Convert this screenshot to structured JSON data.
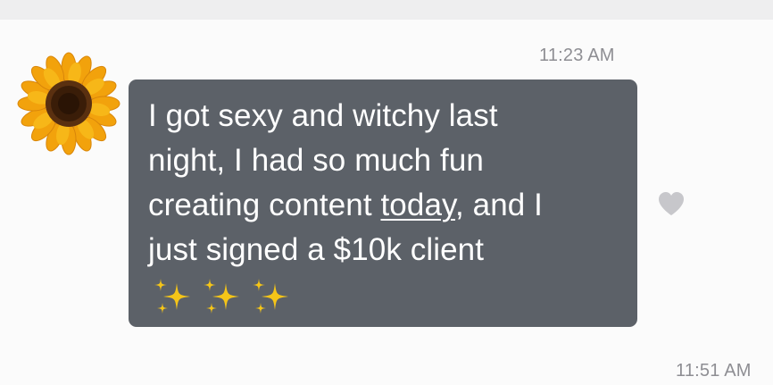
{
  "conversation": {
    "timestamp_first": "11:23 AM",
    "timestamp_second": "11:51 AM",
    "message": {
      "line1": "I got sexy and witchy last",
      "line2": "night, I had so much fun",
      "line3_before": "creating content ",
      "line3_underlined": "today",
      "line3_after": ", and I",
      "line4": "just signed a $10k client",
      "emoji": "sparkles-emoji"
    },
    "avatar_icon": "sunflower-icon",
    "reaction_icon": "heart-icon",
    "colors": {
      "bubble": "#5c6168",
      "text": "#ffffff",
      "timestamp": "#8e8e93",
      "heart": "#c7c7cb"
    }
  }
}
